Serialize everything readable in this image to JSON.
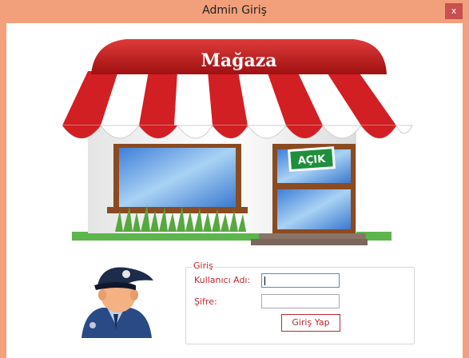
{
  "window": {
    "title": "Admin Giriş",
    "close_label": "x"
  },
  "shop": {
    "sign_text": "Mağaza",
    "door_sign": "AÇIK"
  },
  "login": {
    "group_title": "Giriş",
    "username_label": "Kullanıcı Adı:",
    "username_value": "",
    "password_label": "Şifre:",
    "password_value": "",
    "submit_label": "Giriş Yap"
  },
  "colors": {
    "title_bar": "#f2a07b",
    "accent_red": "#c0272d",
    "focus_border": "#4a90c9"
  }
}
